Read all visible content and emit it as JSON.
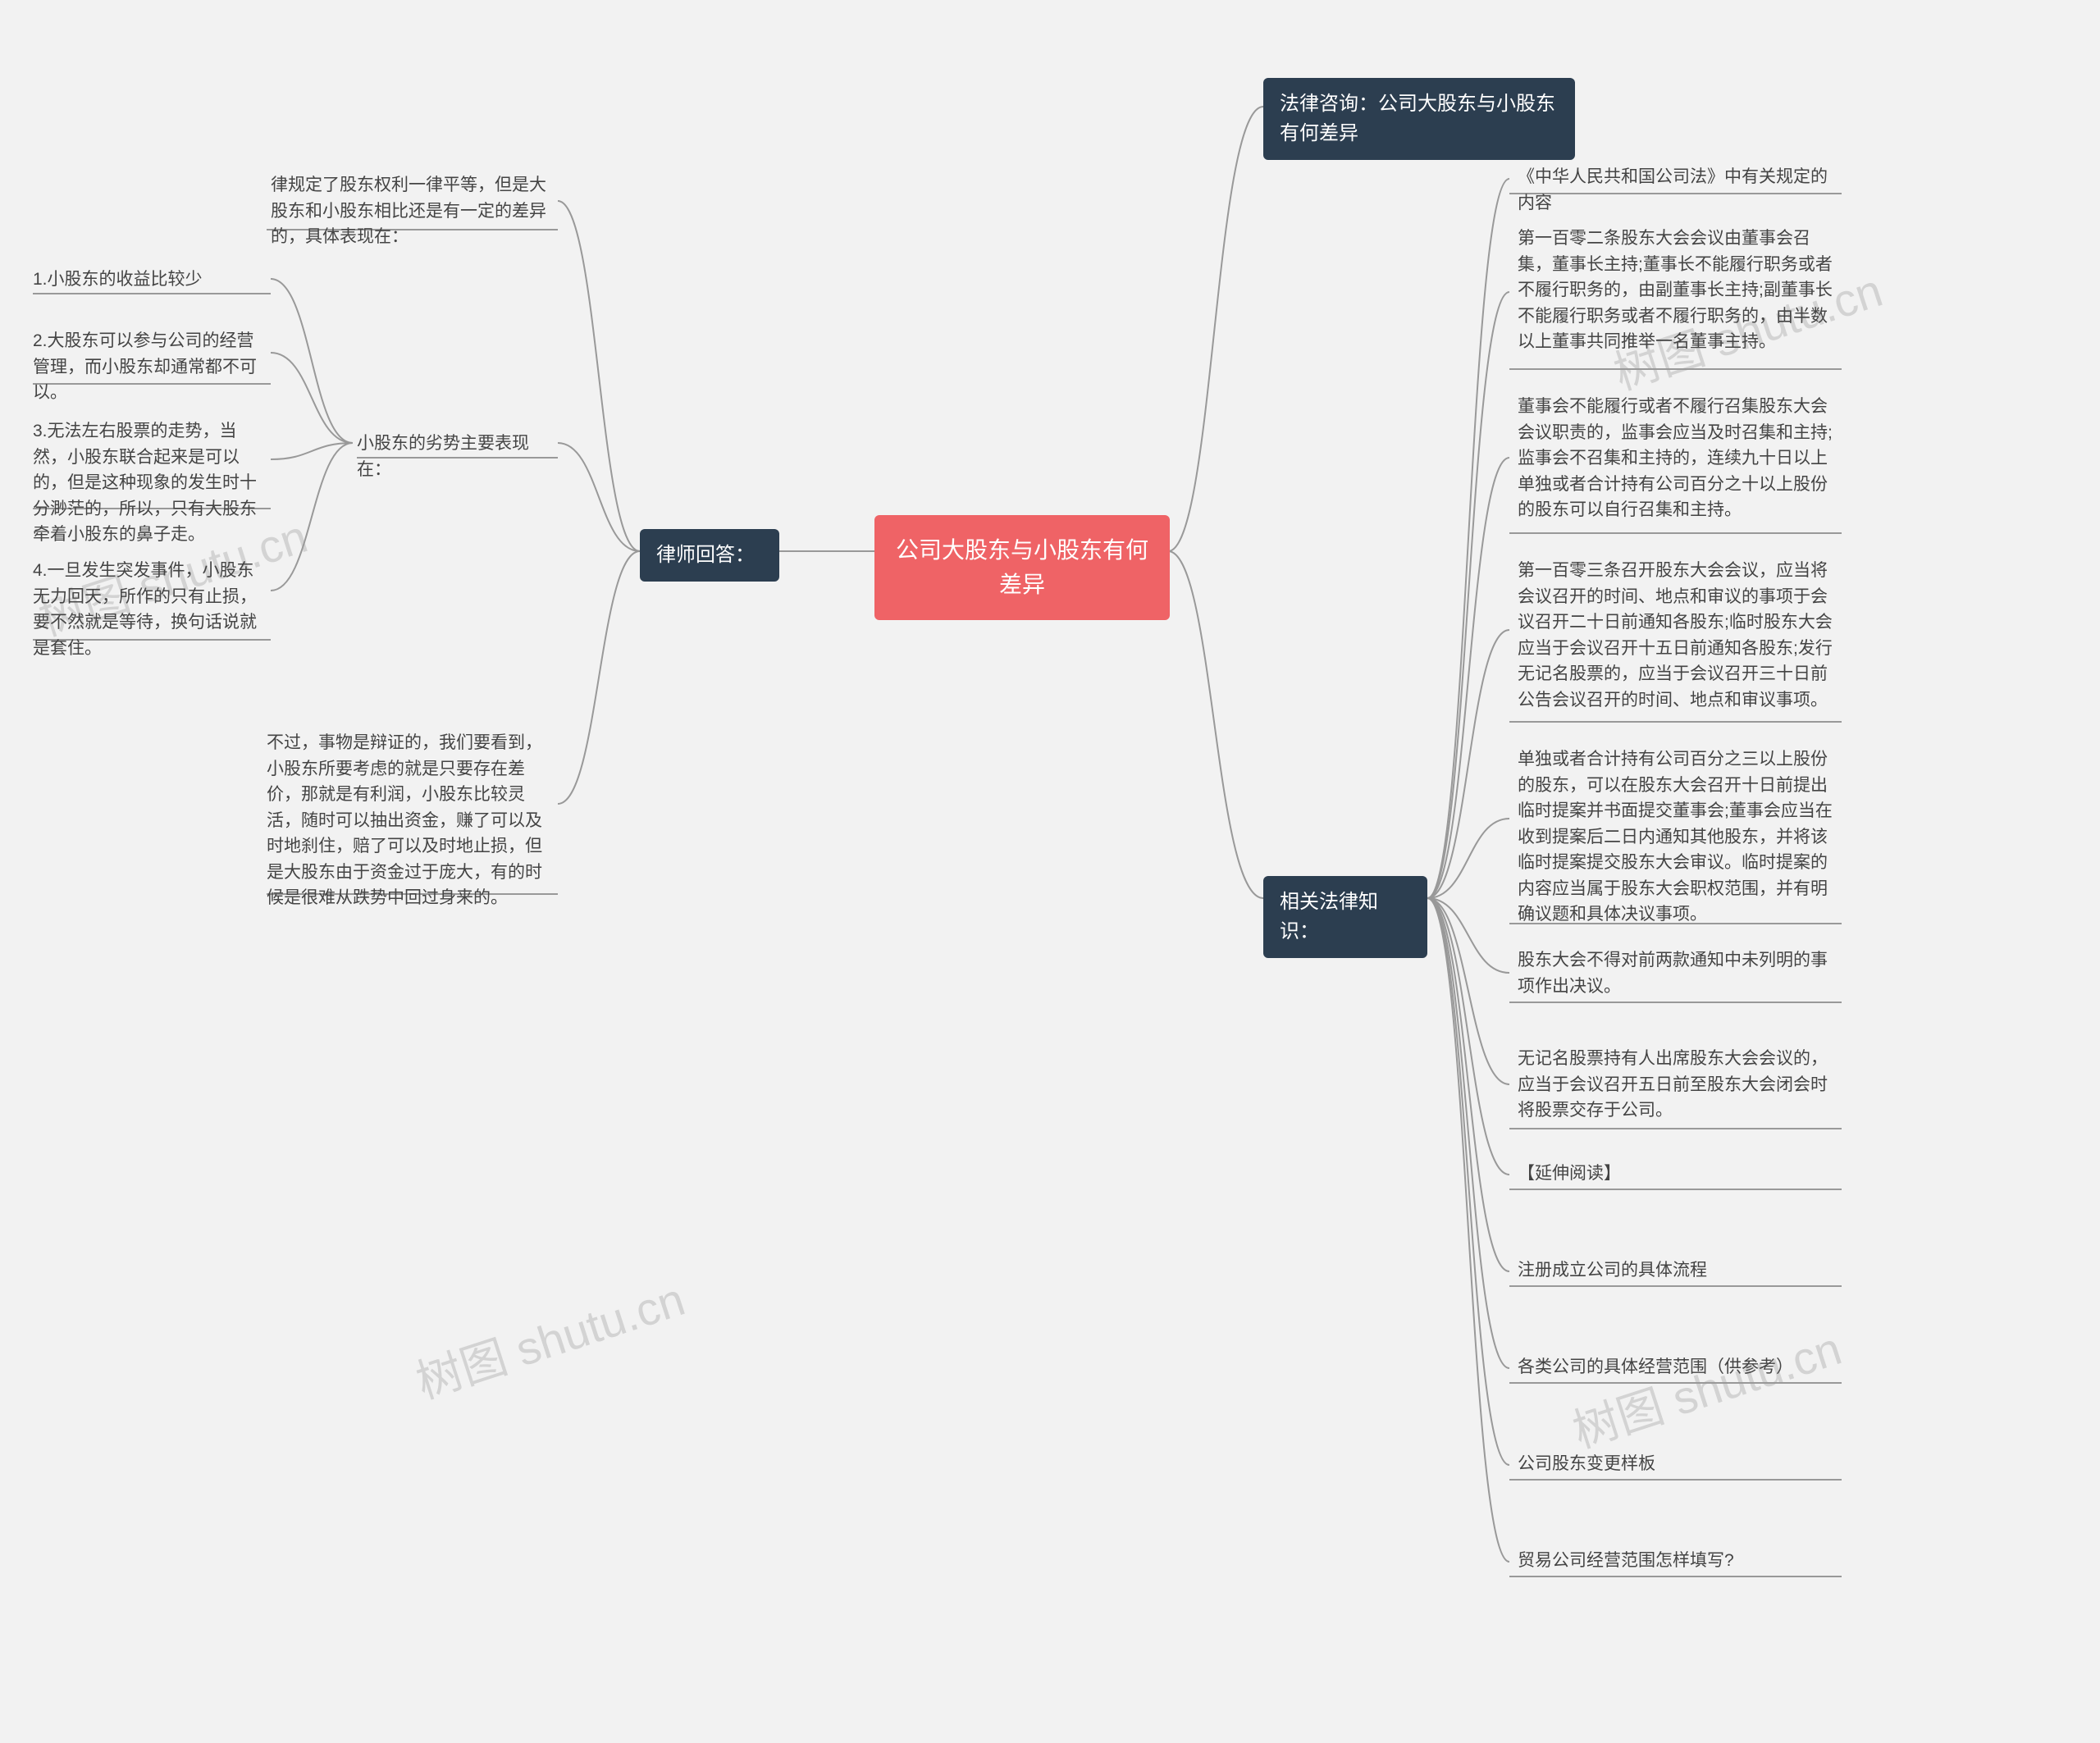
{
  "root": "公司大股东与小股东有何差异",
  "branch_consult": "法律咨询：公司大股东与小股东有何差异",
  "branch_lawyer": "律师回答：",
  "branch_legal": "相关法律知识：",
  "lawyer_children": {
    "c0": "律规定了股东权利一律平等，但是大股东和小股东相比还是有一定的差异的，具体表现在：",
    "c1": "小股东的劣势主要表现在：",
    "c1_sub": {
      "s0": "1.小股东的收益比较少",
      "s1": "2.大股东可以参与公司的经营管理，而小股东却通常都不可以。",
      "s2": "3.无法左右股票的走势，当然，小股东联合起来是可以的，但是这种现象的发生时十分渺茫的，所以，只有大股东牵着小股东的鼻子走。",
      "s3": "4.一旦发生突发事件，小股东无力回天，所作的只有止损，要不然就是等待，换句话说就是套住。"
    },
    "c2": "不过，事物是辩证的，我们要看到，小股东所要考虑的就是只要存在差价，那就是有利润，小股东比较灵活，随时可以抽出资金，赚了可以及时地刹住，赔了可以及时地止损，但是大股东由于资金过于庞大，有的时候是很难从跌势中回过身来的。"
  },
  "legal_children": {
    "k0": "《中华人民共和国公司法》中有关规定的内容",
    "k1": "第一百零二条股东大会会议由董事会召集，董事长主持;董事长不能履行职务或者不履行职务的，由副董事长主持;副董事长不能履行职务或者不履行职务的，由半数以上董事共同推举一名董事主持。",
    "k2": "董事会不能履行或者不履行召集股东大会会议职责的，监事会应当及时召集和主持;监事会不召集和主持的，连续九十日以上单独或者合计持有公司百分之十以上股份的股东可以自行召集和主持。",
    "k3": "第一百零三条召开股东大会会议，应当将会议召开的时间、地点和审议的事项于会议召开二十日前通知各股东;临时股东大会应当于会议召开十五日前通知各股东;发行无记名股票的，应当于会议召开三十日前公告会议召开的时间、地点和审议事项。",
    "k4": "单独或者合计持有公司百分之三以上股份的股东，可以在股东大会召开十日前提出临时提案并书面提交董事会;董事会应当在收到提案后二日内通知其他股东，并将该临时提案提交股东大会审议。临时提案的内容应当属于股东大会职权范围，并有明确议题和具体决议事项。",
    "k5": "股东大会不得对前两款通知中未列明的事项作出决议。",
    "k6": "无记名股票持有人出席股东大会会议的，应当于会议召开五日前至股东大会闭会时将股票交存于公司。",
    "k7": "【延伸阅读】",
    "k8": "注册成立公司的具体流程",
    "k9": "各类公司的具体经营范围（供参考）",
    "k10": "公司股东变更样板",
    "k11": "贸易公司经营范围怎样填写?"
  },
  "watermarks": {
    "w1": "树图 shutu.cn",
    "w2": "树图 shutu.cn",
    "w3": "树图 shutu.cn",
    "w4": "树图 shutu.cn"
  }
}
